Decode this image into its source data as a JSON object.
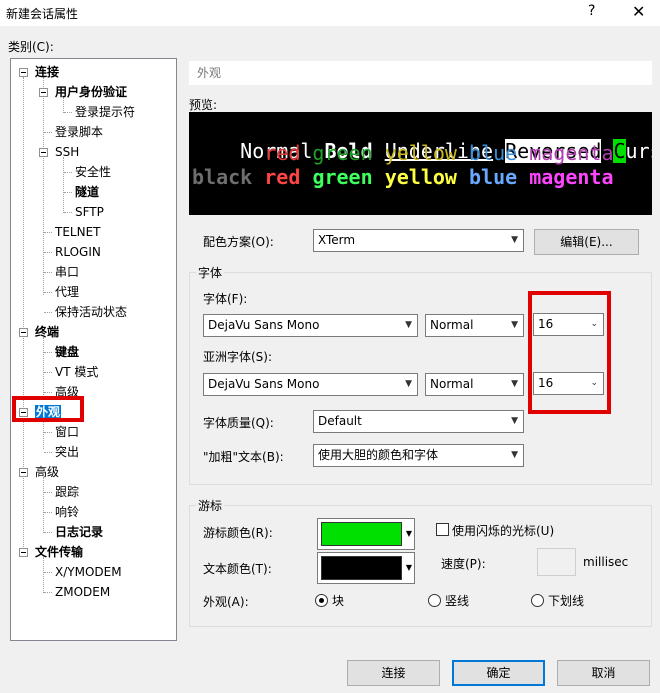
{
  "window": {
    "title": "新建会话属性",
    "help": "?",
    "close": "✕"
  },
  "category_label": "类别(C):",
  "tree": {
    "connection": "连接",
    "user_auth": "用户身份验证",
    "login_prompt": "登录提示符",
    "login_script": "登录脚本",
    "ssh": "SSH",
    "security": "安全性",
    "tunnel": "隧道",
    "sftp": "SFTP",
    "telnet": "TELNET",
    "rlogin": "RLOGIN",
    "serial": "串口",
    "proxy": "代理",
    "keepalive": "保持活动状态",
    "terminal": "终端",
    "keyboard": "键盘",
    "vt_mode": "VT 模式",
    "advanced": "高级",
    "appearance": "外观",
    "window": "窗口",
    "highlight": "突出",
    "advanced2": "高级",
    "trace": "跟踪",
    "bell": "响铃",
    "logging": "日志记录",
    "file_transfer": "文件传输",
    "xymodem": "X/YMODEM",
    "zmodem": "ZMODEM"
  },
  "section_title": "外观",
  "preview": {
    "label": "预览:",
    "line1": {
      "normal": "Normal",
      "bold": "Bold",
      "underline": "Underline",
      "reversed": "Reversed",
      "cursor_char": "C",
      "cursor_rest": "urse"
    },
    "line2": {
      "red": "red",
      "green": "green",
      "yellow": "yellow",
      "blue": "blue",
      "magenta": "magenta"
    },
    "line3": {
      "black": "black",
      "red": "red",
      "green": "green",
      "yellow": "yellow",
      "blue": "blue",
      "magenta": "magenta"
    }
  },
  "color_scheme": {
    "label": "配色方案(O):",
    "value": "XTerm",
    "edit_button": "编辑(E)..."
  },
  "font_group": {
    "legend": "字体",
    "font_label": "字体(F):",
    "font_value": "DejaVu Sans Mono",
    "font_style": "Normal",
    "font_size": "16",
    "asian_label": "亚洲字体(S):",
    "asian_value": "DejaVu Sans Mono",
    "asian_style": "Normal",
    "asian_size": "16",
    "quality_label": "字体质量(Q):",
    "quality_value": "Default",
    "bold_label": "\"加粗\"文本(B):",
    "bold_value": "使用大胆的颜色和字体"
  },
  "cursor_group": {
    "legend": "游标",
    "cursor_color_label": "游标颜色(R):",
    "text_color_label": "文本颜色(T):",
    "blink_label": "使用闪烁的光标(U)",
    "speed_label": "速度(P):",
    "speed_unit": "millisec",
    "appearance_label": "外观(A):",
    "shape_block": "块",
    "shape_vline": "竖线",
    "shape_underline": "下划线"
  },
  "buttons": {
    "connect": "连接",
    "ok": "确定",
    "cancel": "取消"
  },
  "colors": {
    "accent": "#0078d7",
    "highlight_red": "#e00000",
    "cursor_color": "#00e000",
    "text_color": "#000000",
    "ansi_red": "#e8383a",
    "ansi_green": "#1fa02a",
    "ansi_yellow": "#c8b81c",
    "ansi_blue": "#3a8fd8",
    "ansi_magenta": "#b03db0",
    "bright_black": "#6e6e6e",
    "bright_red": "#ff4444",
    "bright_green": "#3dff5e",
    "bright_yellow": "#ffff44",
    "bright_blue": "#68a8ff",
    "bright_magenta": "#ff44ff"
  }
}
